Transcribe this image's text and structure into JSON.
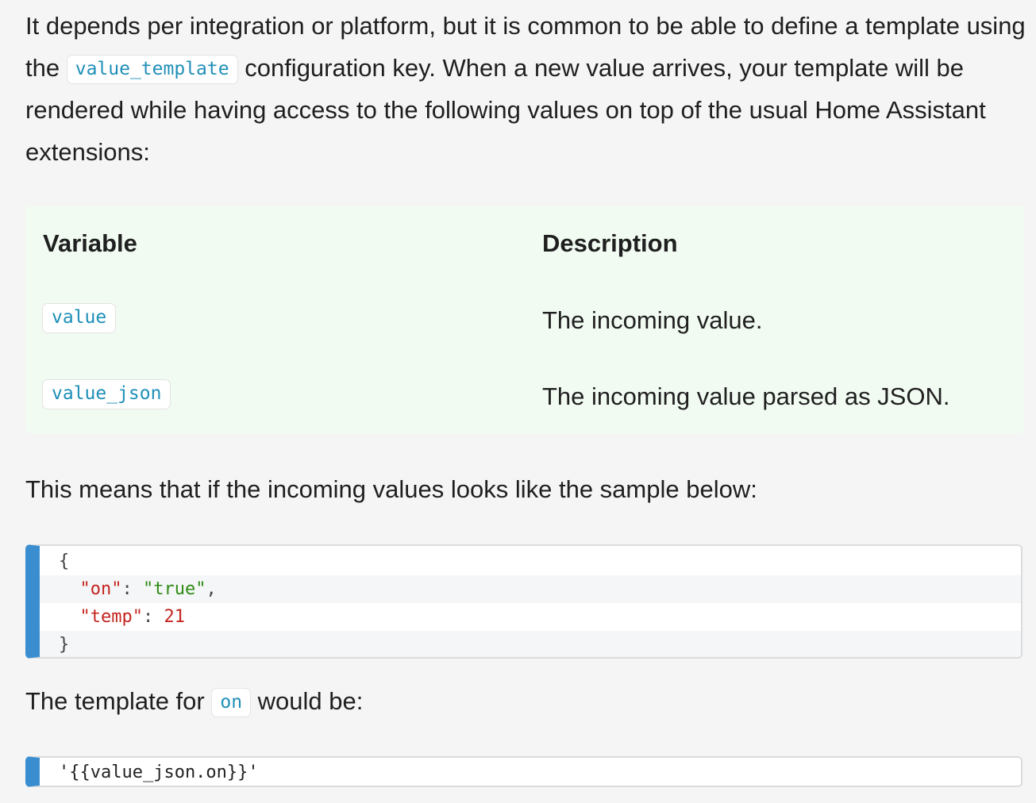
{
  "intro": {
    "text_before": "It depends per integration or platform, but it is common to be able to define a template using the ",
    "code": "value_template",
    "text_after": " configuration key. When a new value arrives, your template will be rendered while having access to the following values on top of the usual Home Assistant extensions:"
  },
  "table": {
    "headers": [
      "Variable",
      "Description"
    ],
    "rows": [
      {
        "variable": "value",
        "description": "The incoming value."
      },
      {
        "variable": "value_json",
        "description": "The incoming value parsed as JSON."
      }
    ]
  },
  "sample_intro": "This means that if the incoming values looks like the sample below:",
  "sample_code": {
    "open_brace": "{",
    "on_key": "\"on\"",
    "on_value": "\"true\"",
    "temp_key": "\"temp\"",
    "temp_value": "21",
    "close_brace": "}"
  },
  "template_intro": {
    "text_before": "The template for ",
    "code": "on",
    "text_after": " would be:"
  },
  "template_code": "'{{value_json.on}}'"
}
